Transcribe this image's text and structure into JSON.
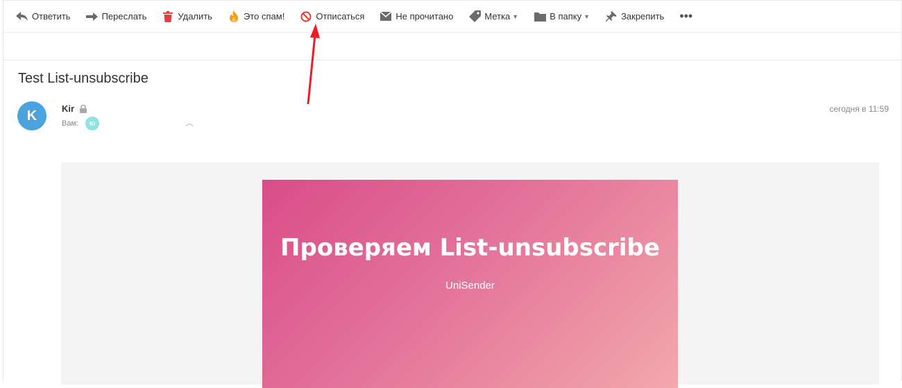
{
  "toolbar": {
    "reply": "Ответить",
    "forward": "Переслать",
    "delete": "Удалить",
    "spam": "Это спам!",
    "unsubscribe": "Отписаться",
    "unread": "Не прочитано",
    "label": "Метка",
    "to_folder": "В папку",
    "pin": "Закрепить",
    "more": "•••"
  },
  "colors": {
    "avatar": "#4aa3df",
    "delete_icon": "#e0403f",
    "spam_icon": "#f39c1a",
    "unsubscribe_icon": "#e53935",
    "arrow": "#ee1c25",
    "banner_start": "#d94d88",
    "banner_end": "#f3a8ab"
  },
  "message": {
    "subject": "Test List-unsubscribe",
    "avatar_letter": "K",
    "sender": "Kir",
    "to_label": "Вам:",
    "recipient_initials": "KI",
    "date": "сегодня в 11:59"
  },
  "body": {
    "banner_title": "Проверяем List-unsubscribe",
    "banner_subtitle": "UniSender"
  }
}
